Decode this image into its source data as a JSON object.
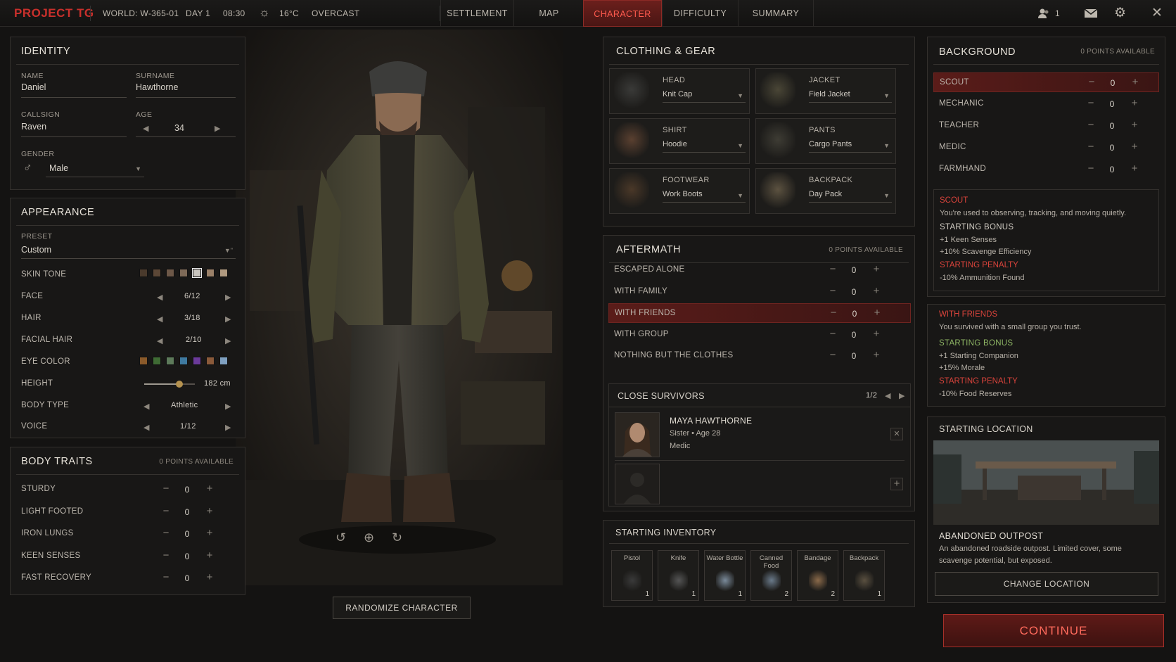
{
  "topbar": {
    "logo": "PROJECT TG",
    "world": "WORLD: W-365-01",
    "day": "DAY 1",
    "time": "08:30",
    "temp": "16°C",
    "weather": "OVERCAST",
    "tabs": [
      "SETTLEMENT",
      "MAP",
      "CHARACTER",
      "DIFFICULTY",
      "SUMMARY"
    ],
    "active_tab": "CHARACTER",
    "players": "1",
    "icons": [
      "sun-icon",
      "users-icon",
      "mail-icon",
      "gear-icon",
      "close-icon"
    ]
  },
  "identity": {
    "title": "IDENTITY",
    "name_label": "NAME",
    "name": "Daniel",
    "surname_label": "SURNAME",
    "surname": "Hawthorne",
    "callsign_label": "CALLSIGN",
    "callsign": "Raven",
    "age_label": "AGE",
    "age": "34",
    "gender_label": "GENDER",
    "gender": "Male"
  },
  "appearance": {
    "title": "APPEARANCE",
    "preset_label": "PRESET",
    "preset": "Custom",
    "skin_label": "SKIN TONE",
    "skin_colors": [
      "#4a3a2c",
      "#5c4736",
      "#6d5848",
      "#7e6a58",
      "#c8c4be",
      "#9a8068",
      "#b09a80"
    ],
    "skin_selected": 4,
    "face_label": "FACE",
    "face": "6/12",
    "hair_label": "HAIR",
    "hair": "3/18",
    "facial_hair_label": "FACIAL HAIR",
    "facial_hair": "2/10",
    "eye_label": "EYE COLOR",
    "eye_colors": [
      "#8a5a2a",
      "#3f6b34",
      "#5d7a5a",
      "#3f7aa0",
      "#6b3a9a",
      "#8a5a3a",
      "#7fa0c0"
    ],
    "height_label": "HEIGHT",
    "height": "182 cm",
    "height_fraction": 0.7,
    "body_label": "BODY TYPE",
    "body": "Athletic",
    "voice_label": "VOICE",
    "voice": "1/12"
  },
  "body_traits": {
    "title": "BODY TRAITS",
    "points": "0 POINTS AVAILABLE",
    "items": [
      {
        "label": "STURDY",
        "value": "0"
      },
      {
        "label": "LIGHT FOOTED",
        "value": "0"
      },
      {
        "label": "IRON LUNGS",
        "value": "0"
      },
      {
        "label": "KEEN SENSES",
        "value": "0"
      },
      {
        "label": "FAST RECOVERY",
        "value": "0"
      }
    ]
  },
  "character_controls": {
    "randomize": "RANDOMIZE CHARACTER"
  },
  "clothing": {
    "title": "CLOTHING & GEAR",
    "items": [
      {
        "slot": "HEAD",
        "item": "Knit Cap"
      },
      {
        "slot": "JACKET",
        "item": "Field Jacket"
      },
      {
        "slot": "SHIRT",
        "item": "Hoodie"
      },
      {
        "slot": "PANTS",
        "item": "Cargo Pants"
      },
      {
        "slot": "FOOTWEAR",
        "item": "Work Boots"
      },
      {
        "slot": "BACKPACK",
        "item": "Day Pack"
      }
    ]
  },
  "aftermath": {
    "title": "AFTERMATH",
    "points": "0 POINTS AVAILABLE",
    "items": [
      {
        "label": "ESCAPED ALONE",
        "value": "0"
      },
      {
        "label": "WITH FAMILY",
        "value": "0"
      },
      {
        "label": "WITH FRIENDS",
        "value": "0"
      },
      {
        "label": "WITH GROUP",
        "value": "0"
      },
      {
        "label": "NOTHING BUT THE CLOTHES",
        "value": "0"
      }
    ],
    "selected": 2
  },
  "close_survivors": {
    "title": "CLOSE SURVIVORS",
    "page": "1/2",
    "survivor": {
      "name": "MAYA HAWTHORNE",
      "relation": "Sister • Age 28",
      "role": "Medic"
    }
  },
  "inventory": {
    "title": "STARTING INVENTORY",
    "items": [
      {
        "name": "Pistol",
        "count": "1"
      },
      {
        "name": "Knife",
        "count": "1"
      },
      {
        "name": "Water Bottle",
        "count": "1"
      },
      {
        "name": "Canned Food",
        "count": "2"
      },
      {
        "name": "Bandage",
        "count": "2"
      },
      {
        "name": "Backpack",
        "count": "1"
      }
    ]
  },
  "background": {
    "title": "BACKGROUND",
    "points": "0 POINTS AVAILABLE",
    "items": [
      {
        "label": "SCOUT",
        "value": "0"
      },
      {
        "label": "MECHANIC",
        "value": "0"
      },
      {
        "label": "TEACHER",
        "value": "0"
      },
      {
        "label": "MEDIC",
        "value": "0"
      },
      {
        "label": "FARMHAND",
        "value": "0"
      }
    ],
    "selected": 0,
    "info": {
      "name": "SCOUT",
      "desc": "You're used to observing, tracking, and moving quietly.",
      "bonus_label": "STARTING BONUS",
      "bonus": [
        "+1 Keen Senses",
        "+10% Scavenge Efficiency"
      ],
      "penalty_label": "STARTING PENALTY",
      "penalty": [
        "-10% Ammunition Found"
      ]
    }
  },
  "aftermath_info": {
    "name": "WITH FRIENDS",
    "desc": "You survived with a small group you trust.",
    "bonus_label": "STARTING BONUS",
    "bonus": [
      "+1 Starting Companion",
      "+15% Morale"
    ],
    "penalty_label": "STARTING PENALTY",
    "penalty": [
      "-10% Food Reserves"
    ]
  },
  "location": {
    "title": "STARTING LOCATION",
    "name": "ABANDONED OUTPOST",
    "desc1": "An abandoned roadside outpost. Limited cover, some",
    "desc2": "scavenge potential, but exposed.",
    "change": "CHANGE LOCATION"
  },
  "continue": "CONTINUE"
}
